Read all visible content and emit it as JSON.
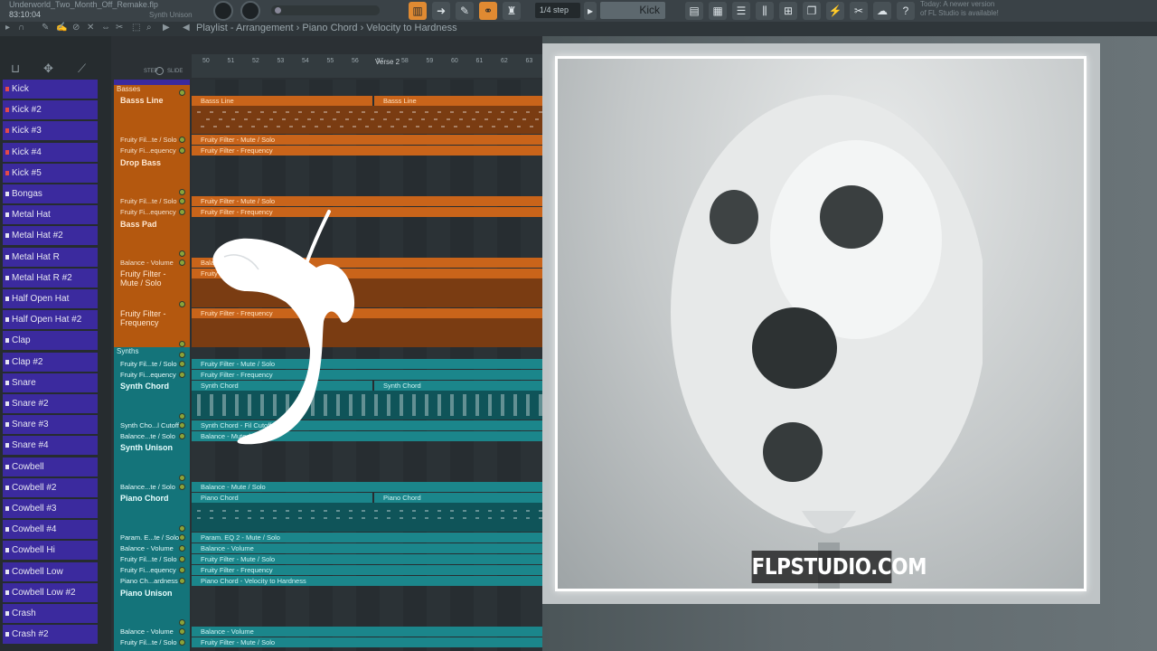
{
  "topbar": {
    "file_name": "Underworld_Two_Month_Off_Remake.flp",
    "time": "83:10:04",
    "hint_label": "Synth Unison",
    "snap": "1/4 step",
    "pattern": "Kick",
    "news_line1": "Today: A newer version",
    "news_line2": "of FL Studio is available!"
  },
  "breadcrumb": "Playlist - Arrangement › Piano Chord › Velocity to Hardness",
  "rack": {
    "step_label": "STEP",
    "slide_label": "SLIDE",
    "channels": [
      "Kick",
      "Kick #2",
      "Kick #3",
      "Kick #4",
      "Kick #5",
      "Bongas",
      "Metal Hat",
      "Metal Hat #2",
      "Metal Hat R",
      "Metal Hat R #2",
      "Half Open Hat",
      "Half Open Hat #2",
      "Clap",
      "Clap #2",
      "Snare",
      "Snare #2",
      "Snare #3",
      "Snare #4",
      "Cowbell",
      "Cowbell #2",
      "Cowbell #3",
      "Cowbell #4",
      "Cowbell Hi",
      "Cowbell Low",
      "Cowbell Low #2",
      "Crash",
      "Crash #2"
    ]
  },
  "ruler": {
    "bars": [
      "50",
      "51",
      "52",
      "53",
      "54",
      "55",
      "56",
      "57",
      "58",
      "59",
      "60",
      "61",
      "62",
      "63"
    ],
    "marker": "Verse 2"
  },
  "groups": {
    "basses": "Basses",
    "synths": "Synths"
  },
  "tracks": {
    "basss_line": "Basss Line",
    "drop_bass": "Drop Bass",
    "bass_pad": "Bass Pad",
    "ff_mute_solo": "Fruity Filter - Mute / Solo",
    "ff_frequency": "Fruity Filter - Frequency",
    "synth_chord": "Synth Chord",
    "synth_unison": "Synth Unison",
    "piano_chord": "Piano Chord",
    "piano_unison": "Piano Unison"
  },
  "lanes": {
    "ff_solo_short": "Fruity Fil...te / Solo",
    "ff_freq_short": "Fruity Fi...equency",
    "balance_volume": "Balance - Volume",
    "synth_cutoff": "Synth Cho...l Cutoff",
    "balance_solo": "Balance...te / Solo",
    "param_eq": "Param. E...te / Solo",
    "piano_hardness": "Piano Ch...ardness"
  },
  "clips": {
    "basss_line": "Basss Line",
    "ff_mute_solo": "Fruity Filter - Mute / Solo",
    "ff_frequency": "Fruity Filter - Frequency",
    "synth_chord": "Synth Chord",
    "synth_chord_cutoff": "Synth Chord - Fil Cutoff",
    "balance_volume": "Balance - Volume",
    "balance_mute": "Balance - Mute / Solo",
    "piano_chord": "Piano Chord",
    "param_eq": "Param. EQ 2 - Mute / Solo",
    "piano_hardness": "Piano Chord - Velocity to Hardness"
  },
  "watermark": "FLPSTUDIO.COM",
  "colors": {
    "channel": "#3b2a9e",
    "orange_track": "#c9641a",
    "teal_track": "#1b868b",
    "accent": "#e08a32"
  }
}
